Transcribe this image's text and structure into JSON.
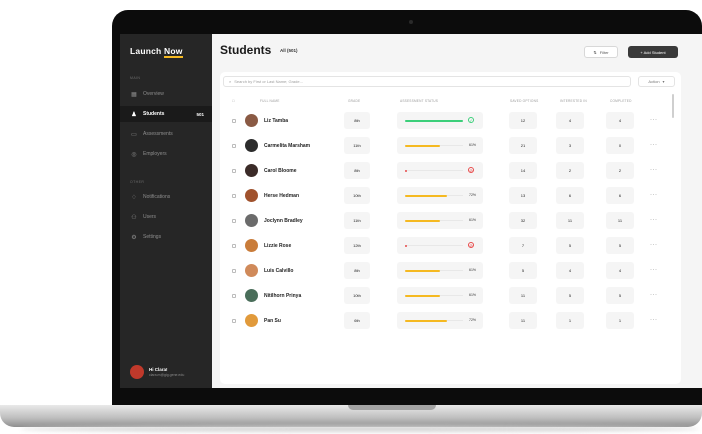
{
  "sidebar": {
    "logo_launch": "Launch",
    "logo_now": "Now",
    "section_main": "MAIN",
    "section_other": "OTHER",
    "items": [
      {
        "label": "Overview",
        "icon": "grid-icon"
      },
      {
        "label": "Students",
        "count": "501",
        "icon": "user-icon",
        "active": true
      },
      {
        "label": "Assessments",
        "icon": "clipboard-icon"
      },
      {
        "label": "Employers",
        "icon": "briefcase-icon"
      },
      {
        "label": "Notifications",
        "icon": "bell-icon"
      },
      {
        "label": "Users",
        "icon": "users-icon"
      },
      {
        "label": "Settings",
        "icon": "gear-icon"
      }
    ],
    "user": {
      "name": "Hi Clara!",
      "email": "clara.m@gig.gene.edu"
    }
  },
  "header": {
    "title": "Students",
    "subtitle": "All (501)",
    "filter_label": "Filter",
    "add_label": "+ Add Student"
  },
  "toolbar": {
    "search_placeholder": "Search by First or Last Name; Grade...",
    "action_label": "Action"
  },
  "table": {
    "columns": [
      "FULL NAME",
      "GRADE",
      "ASSESSMENT STATUS",
      "SAVED OPTIONS",
      "INTERESTED IN",
      "COMPLETED"
    ],
    "rows": [
      {
        "name": "Liz Tamba",
        "grade": "8th",
        "progress": 1.0,
        "status": "complete",
        "saved": "12",
        "interested": "4",
        "completed": "4"
      },
      {
        "name": "Carmelita Marsham",
        "grade": "11th",
        "progress": 0.61,
        "pct": "61%",
        "saved": "21",
        "interested": "3",
        "completed": "0"
      },
      {
        "name": "Carol Bloome",
        "grade": "8th",
        "progress": 0.02,
        "status": "blocked",
        "saved": "14",
        "interested": "2",
        "completed": "2"
      },
      {
        "name": "Herse Hedman",
        "grade": "10th",
        "progress": 0.72,
        "pct": "72%",
        "saved": "13",
        "interested": "6",
        "completed": "6"
      },
      {
        "name": "Joclynn Bradley",
        "grade": "11th",
        "progress": 0.61,
        "pct": "61%",
        "saved": "32",
        "interested": "11",
        "completed": "11"
      },
      {
        "name": "Lizzie Rose",
        "grade": "12th",
        "progress": 0.02,
        "status": "blocked",
        "saved": "7",
        "interested": "5",
        "completed": "5"
      },
      {
        "name": "Luis Calvillo",
        "grade": "8th",
        "progress": 0.61,
        "pct": "61%",
        "saved": "5",
        "interested": "4",
        "completed": "4"
      },
      {
        "name": "Nitilhorn Prinya",
        "grade": "10th",
        "progress": 0.61,
        "pct": "61%",
        "saved": "11",
        "interested": "5",
        "completed": "5"
      },
      {
        "name": "Pan Su",
        "grade": "6th",
        "progress": 0.72,
        "pct": "72%",
        "saved": "11",
        "interested": "1",
        "completed": "1"
      }
    ]
  },
  "colors": {
    "accent": "#f5b921",
    "complete": "#3ccf7a",
    "blocked": "#e84b4b",
    "sidebar_bg": "#262626"
  }
}
